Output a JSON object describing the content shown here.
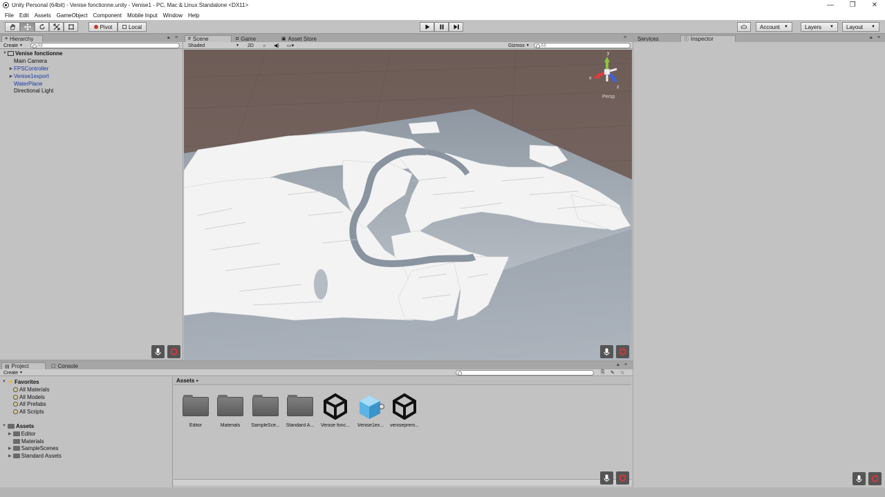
{
  "window": {
    "title": "Unity Personal (64bit) - Venise fonctionne.unity - Venise1 - PC, Mac & Linux Standalone <DX11>",
    "minimize": "—",
    "restore": "❐",
    "close": "✕"
  },
  "menu": [
    "File",
    "Edit",
    "Assets",
    "GameObject",
    "Component",
    "Mobile Input",
    "Window",
    "Help"
  ],
  "toolbar": {
    "pivot": "Pivot",
    "local": "Local",
    "account": "Account",
    "layers": "Layers",
    "layout": "Layout"
  },
  "hierarchy": {
    "tab": "Hierarchy",
    "create": "Create",
    "search_placeholder": "All",
    "scene": "Venise fonctionne",
    "items": [
      {
        "label": "Main Camera",
        "expandable": false,
        "blue": false
      },
      {
        "label": "FPSController",
        "expandable": true,
        "blue": true
      },
      {
        "label": "Venise1export",
        "expandable": true,
        "blue": true
      },
      {
        "label": "WaterPlane",
        "expandable": false,
        "blue": true
      },
      {
        "label": "Directional Light",
        "expandable": false,
        "blue": false
      }
    ]
  },
  "scene": {
    "tabs": [
      "Scene",
      "Game",
      "Asset Store"
    ],
    "shading": "Shaded",
    "mode2d": "2D",
    "gizmos": "Gizmos",
    "search_placeholder": "All",
    "persp": "Persp",
    "axis_x": "x",
    "axis_y": "y",
    "axis_z": "z"
  },
  "inspector": {
    "tabs": [
      "Services",
      "Inspector"
    ]
  },
  "project": {
    "tabs": [
      "Project",
      "Console"
    ],
    "create": "Create",
    "favorites_label": "Favorites",
    "favorites": [
      "All Materials",
      "All Models",
      "All Prefabs",
      "All Scripts"
    ],
    "assets_label": "Assets",
    "asset_folders": [
      "Editor",
      "Materials",
      "SampleScenes",
      "Standard Assets"
    ],
    "breadcrumb": "Assets",
    "grid": [
      {
        "label": "Editor",
        "kind": "folder"
      },
      {
        "label": "Materials",
        "kind": "folder"
      },
      {
        "label": "SampleSce...",
        "kind": "folder"
      },
      {
        "label": "Standard A...",
        "kind": "folder"
      },
      {
        "label": "Venise fonc...",
        "kind": "unity"
      },
      {
        "label": "Venise1ex...",
        "kind": "model"
      },
      {
        "label": "veniseprem...",
        "kind": "unity"
      }
    ]
  },
  "colors": {
    "panel_bg": "#c2c2c2",
    "sky": "#6b5b56",
    "ground": "#8c959f",
    "buildings": "#f4f4f4",
    "gizmo_y": "#8cc63f",
    "gizmo_x": "#e23b3b",
    "gizmo_z": "#3b63e2"
  }
}
